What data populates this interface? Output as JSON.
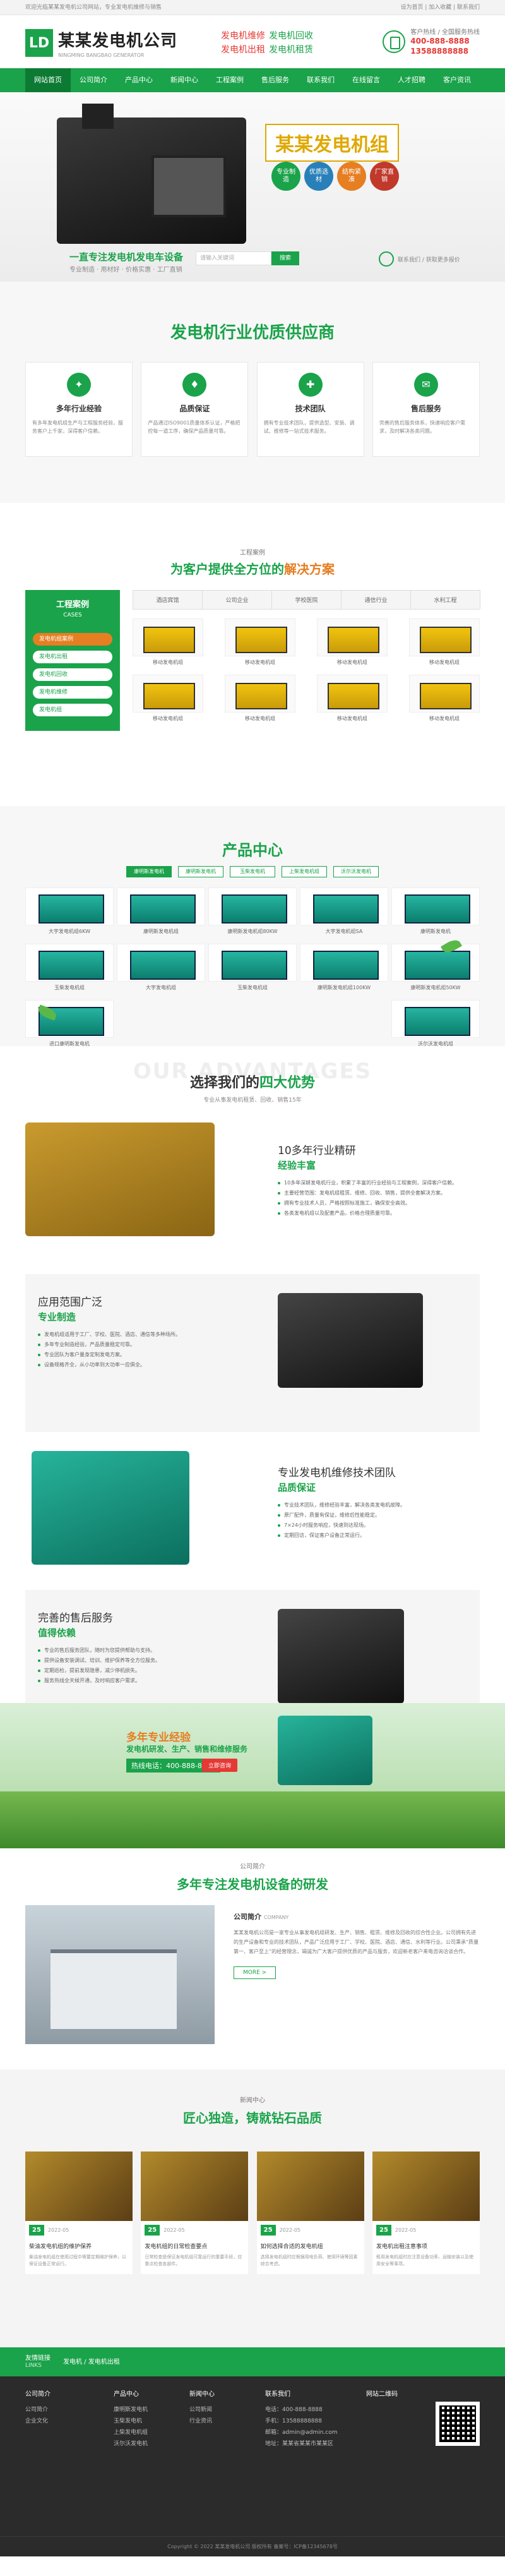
{
  "topbar": {
    "left": "欢迎光临某某发电机公司网站，专业发电机维修与销售",
    "right": "设为首页 | 加入收藏 | 联系我们"
  },
  "header": {
    "logo_mark": "LD",
    "company": "某某发电机公司",
    "company_en": "NINGMING BANGBAO GENERATOR",
    "slogans": [
      [
        "发电机维修",
        "发电机回收"
      ],
      [
        "发电机出租",
        "发电机租赁"
      ]
    ],
    "hotline_label": "客户热线 / 全国服务热线",
    "hotline_1": "400-888-8888",
    "hotline_2": "13588888888"
  },
  "nav": [
    "网站首页",
    "公司简介",
    "产品中心",
    "新闻中心",
    "工程案例",
    "售后服务",
    "联系我们",
    "在线留言",
    "人才招聘",
    "客户资讯"
  ],
  "banner": {
    "title": "某某发电机组",
    "badges": [
      "专业制造",
      "优质选材",
      "结构紧凑",
      "厂家直销"
    ],
    "slogan": "一直专注发电机发电车设备",
    "sub": "专业制造 · 用材好 · 价格实惠 · 工厂直销",
    "search_placeholder": "请输入关键词",
    "search_btn": "搜索",
    "contact": "联系我们 / 获取更多报价"
  },
  "sec1": {
    "title": "发电机行业优质供应商",
    "cards": [
      {
        "icon": "✦",
        "h": "多年行业经验",
        "d": "有多年发电机组生产与工程服务经验，服务客户上千家，深得客户信赖。"
      },
      {
        "icon": "♦",
        "h": "品质保证",
        "d": "产品通过ISO9001质量体系认证，严格把控每一道工序，确保产品质量可靠。"
      },
      {
        "icon": "✚",
        "h": "技术团队",
        "d": "拥有专业技术团队，提供选型、安装、调试、维修等一站式技术服务。"
      },
      {
        "icon": "✉",
        "h": "售后服务",
        "d": "完善的售后服务体系，快速响应客户需求，及时解决各类问题。"
      }
    ]
  },
  "sec2": {
    "tag": "工程案例",
    "title_a": "为客户提供全方位的",
    "title_b": "解决方案",
    "side_title": "工程案例",
    "side_sub": "CASES",
    "side_items": [
      "发电机组案例",
      "发电机出租",
      "发电机回收",
      "发电机维修",
      "发电机组"
    ],
    "tabs": [
      "酒店宾馆",
      "公司企业",
      "学校医院",
      "通信行业",
      "水利工程"
    ],
    "cases": [
      "移动发电机组",
      "移动发电机组",
      "移动发电机组",
      "移动发电机组",
      "移动发电机组",
      "移动发电机组",
      "移动发电机组",
      "移动发电机组"
    ]
  },
  "sec3": {
    "title": "产品中心",
    "cats": [
      "康明斯发电机",
      "康明斯发电机",
      "玉柴发电机",
      "上柴发电机组",
      "沃尔沃发电机"
    ],
    "prods": [
      "大宇发电机组6KW",
      "康明斯发电机组",
      "康明斯发电机组80KW",
      "大宇发电机组SA",
      "康明斯发电机",
      "玉柴发电机组",
      "大宇发电机组",
      "玉柴发电机组",
      "康明斯发电机组100KW",
      "康明斯发电机组50KW",
      "进口康明斯发电机",
      "沃尔沃发电机组"
    ]
  },
  "sec4": {
    "ghost": "OUR ADVANTAGES",
    "title_a": "选择我们的",
    "title_b": "四大优势",
    "sub": "专业从事发电机租赁、回收、销售15年",
    "advs": [
      {
        "h1": "10多年行业精研",
        "h2": "经验丰富",
        "items": [
          "10多年深耕发电机行业，积累了丰富的行业经验与工程案例，深得客户信赖。",
          "主要经营范围：发电机组租赁、维修、回收、销售，提供全套解决方案。",
          "拥有专业技术人员，严格按照标准施工，确保安全高效。",
          "各类发电机组以及配套产品，价格合理质量可靠。"
        ]
      },
      {
        "h1": "应用范围广泛",
        "h2": "专业制造",
        "items": [
          "发电机组适用于工厂、学校、医院、酒店、通信等多种场所。",
          "多年专业制造经验，产品质量稳定可靠。",
          "专业团队为客户量身定制发电方案。",
          "设备规格齐全，从小功率到大功率一应俱全。"
        ]
      },
      {
        "h1": "专业发电机维修技术团队",
        "h2": "品质保证",
        "items": [
          "专业技术团队，维修经验丰富，解决各类发电机故障。",
          "原厂配件，质量有保证，维修后性能稳定。",
          "7×24小时服务响应，快速到达现场。",
          "定期回访，保证客户设备正常运行。"
        ]
      },
      {
        "h1": "完善的售后服务",
        "h2": "值得依赖",
        "items": [
          "专业的售后服务团队，随时为您提供帮助与支持。",
          "提供设备安装调试、培训、维护保养等全方位服务。",
          "定期巡检，提前发现隐患，减少停机损失。",
          "服务热线全天候开通，及时响应客户需求。"
        ]
      }
    ]
  },
  "sec5": {
    "t1": "多年专业经验",
    "t2": "发电机研发、生产、销售和维修服务",
    "t3": "热线电话：400-888-8888",
    "btn": "立即咨询"
  },
  "sec6": {
    "tag": "公司简介",
    "title": "多年专注发电机设备的研发",
    "h": "公司简介",
    "e": "COMPANY",
    "p": "某某发电机公司是一家专业从事发电机组研发、生产、销售、租赁、维修及回收的综合性企业。公司拥有先进的生产设备和专业的技术团队，产品广泛应用于工厂、学校、医院、酒店、通信、水利等行业。公司秉承“质量第一、客户至上”的经营理念，竭诚为广大客户提供优质的产品与服务，欢迎新老客户来电咨询洽谈合作。",
    "more": "MORE >"
  },
  "sec7": {
    "tag": "新闻中心",
    "title": "匠心独造，铸就钻石品质",
    "news": [
      {
        "day": "25",
        "ym": "2022-05",
        "tt": "柴油发电机组的维护保养",
        "ds": "柴油发电机组在使用过程中需要定期维护保养，以保证设备正常运行。"
      },
      {
        "day": "25",
        "ym": "2022-05",
        "tt": "发电机组的日常检查要点",
        "ds": "日常检查是保证发电机组可靠运行的重要手段，应重点检查各部件。"
      },
      {
        "day": "25",
        "ym": "2022-05",
        "tt": "如何选择合适的发电机组",
        "ds": "选择发电机组时应根据用电负荷、使用环境等因素综合考虑。"
      },
      {
        "day": "25",
        "ym": "2022-05",
        "tt": "发电机出租注意事项",
        "ds": "租用发电机组时应注意设备功率、运输安装以及使用安全等事项。"
      }
    ]
  },
  "links": {
    "a": "友情链接",
    "b": "LINKS",
    "c": "发电机 / 发电机出租"
  },
  "footer": {
    "cols": [
      {
        "h": "公司简介",
        "items": [
          "公司简介",
          "企业文化"
        ]
      },
      {
        "h": "产品中心",
        "items": [
          "康明斯发电机",
          "玉柴发电机",
          "上柴发电机组",
          "沃尔沃发电机"
        ]
      },
      {
        "h": "新闻中心",
        "items": [
          "公司新闻",
          "行业资讯"
        ]
      },
      {
        "h": "联系我们",
        "items": [
          "电话：400-888-8888",
          "手机：13588888888",
          "邮箱：admin@admin.com",
          "地址：某某省某某市某某区"
        ]
      },
      {
        "h": "网站二维码",
        "items": []
      }
    ],
    "copy": "Copyright © 2022 某某发电机公司 版权所有  备案号：ICP备12345678号"
  }
}
